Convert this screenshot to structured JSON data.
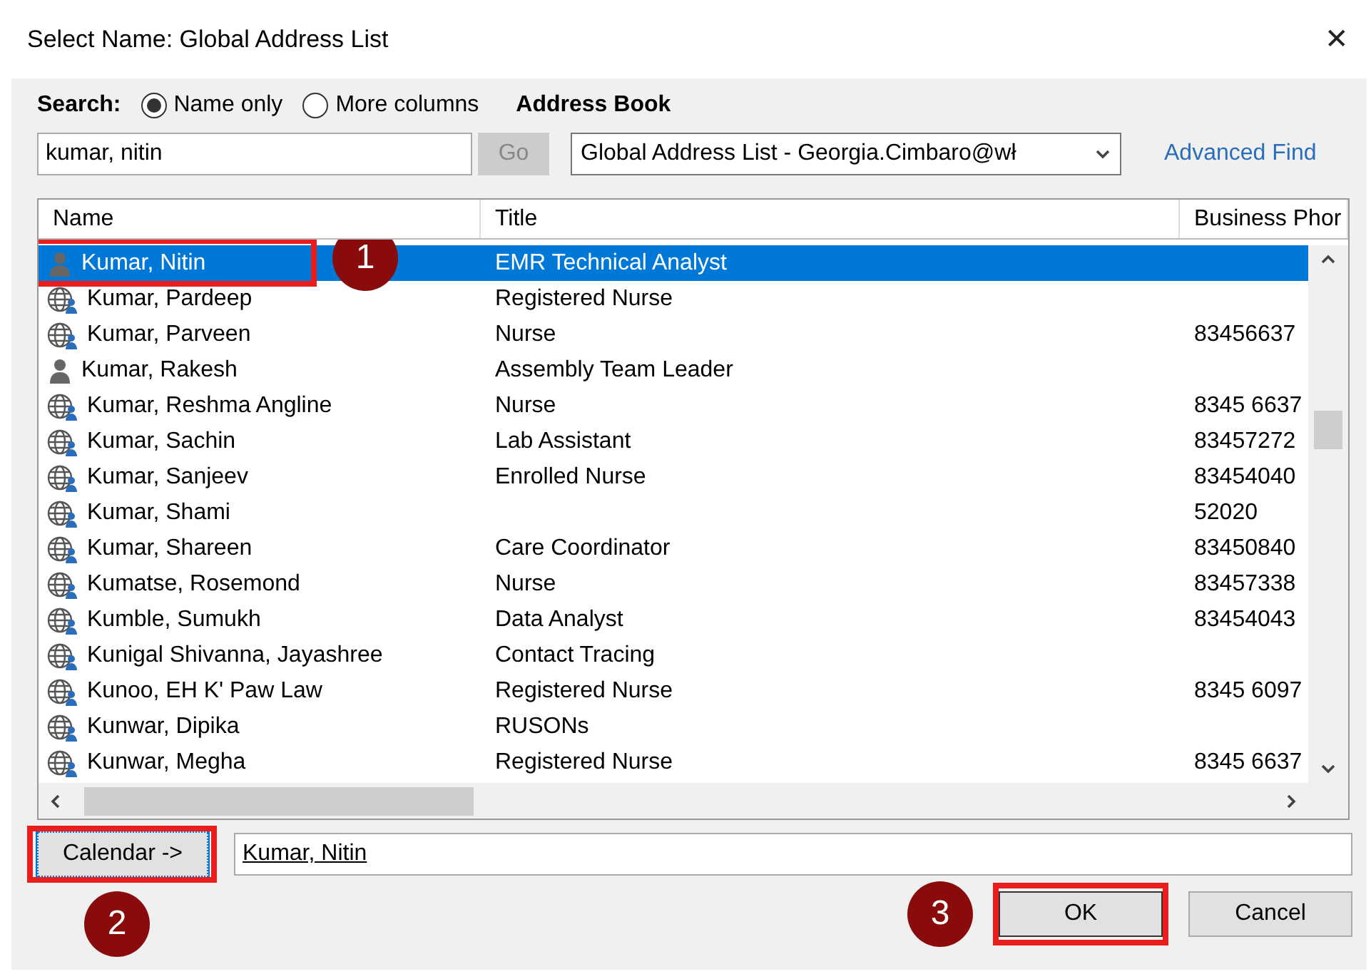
{
  "window": {
    "title": "Select Name: Global Address List",
    "close": "✕"
  },
  "search": {
    "label": "Search:",
    "options": [
      {
        "label": "Name only",
        "selected": true
      },
      {
        "label": "More columns",
        "selected": false
      }
    ],
    "value": "kumar, nitin",
    "go_button": {
      "label": "Go",
      "disabled": true
    }
  },
  "address_book": {
    "label": "Address Book",
    "value": "Global Address List - Georgia.Cimbaro@wł",
    "advanced_find": "Advanced Find"
  },
  "table": {
    "columns": [
      "Name",
      "Title",
      "Business Phor"
    ],
    "rows": [
      {
        "kind": "user",
        "name": "Kumar, Nitin",
        "title": "EMR Technical Analyst",
        "phone": "",
        "selected": true
      },
      {
        "kind": "contact",
        "name": "Kumar, Pardeep",
        "title": "Registered Nurse",
        "phone": "",
        "selected": false
      },
      {
        "kind": "contact",
        "name": "Kumar, Parveen",
        "title": "Nurse",
        "phone": "83456637",
        "selected": false
      },
      {
        "kind": "user",
        "name": "Kumar, Rakesh",
        "title": "Assembly Team Leader",
        "phone": "",
        "selected": false
      },
      {
        "kind": "contact",
        "name": "Kumar, Reshma Angline",
        "title": "Nurse",
        "phone": "8345 6637",
        "selected": false
      },
      {
        "kind": "contact",
        "name": "Kumar, Sachin",
        "title": "Lab Assistant",
        "phone": "83457272",
        "selected": false
      },
      {
        "kind": "contact",
        "name": "Kumar, Sanjeev",
        "title": "Enrolled Nurse",
        "phone": "83454040",
        "selected": false
      },
      {
        "kind": "contact",
        "name": "Kumar, Shami",
        "title": "",
        "phone": "52020",
        "selected": false
      },
      {
        "kind": "contact",
        "name": "Kumar, Shareen",
        "title": "Care Coordinator",
        "phone": "83450840",
        "selected": false
      },
      {
        "kind": "contact",
        "name": "Kumatse, Rosemond",
        "title": "Nurse",
        "phone": "83457338",
        "selected": false
      },
      {
        "kind": "contact",
        "name": "Kumble, Sumukh",
        "title": "Data Analyst",
        "phone": "83454043",
        "selected": false
      },
      {
        "kind": "contact",
        "name": "Kunigal Shivanna, Jayashree",
        "title": "Contact Tracing",
        "phone": "",
        "selected": false
      },
      {
        "kind": "contact",
        "name": "Kunoo, EH K' Paw Law",
        "title": "Registered Nurse",
        "phone": "8345 6097",
        "selected": false
      },
      {
        "kind": "contact",
        "name": "Kunwar, Dipika",
        "title": "RUSONs",
        "phone": "",
        "selected": false
      },
      {
        "kind": "contact",
        "name": "Kunwar, Megha",
        "title": "Registered Nurse",
        "phone": "8345 6637",
        "selected": false
      }
    ]
  },
  "calendar_button": "Calendar ->",
  "calendar_value": "Kumar, Nitin",
  "buttons": [
    {
      "label": "OK",
      "kind": "primary"
    },
    {
      "label": "Cancel",
      "kind": "normal"
    }
  ],
  "annotations": [
    {
      "label": "1"
    },
    {
      "label": "2"
    },
    {
      "label": "3"
    }
  ]
}
